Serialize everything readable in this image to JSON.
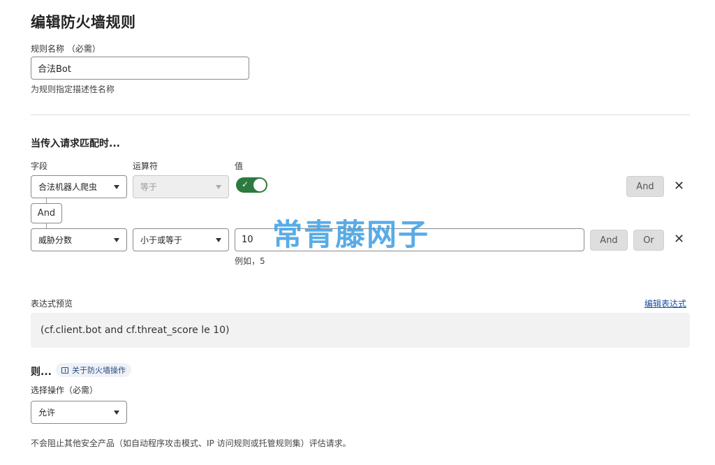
{
  "page": {
    "title": "编辑防火墙规则"
  },
  "rule_name": {
    "label": "规则名称 （必需）",
    "value": "合法Bot",
    "hint": "为规则指定描述性名称"
  },
  "match": {
    "heading": "当传入请求匹配时...",
    "col_field": "字段",
    "col_operator": "运算符",
    "col_value": "值",
    "row1": {
      "field": "合法机器人爬虫",
      "operator": "等于",
      "toggle_on": true,
      "and_label": "And"
    },
    "connector_label": "And",
    "row2": {
      "field": "威胁分数",
      "operator": "小于或等于",
      "value": "10",
      "value_hint": "例如，5",
      "and_label": "And",
      "or_label": "Or"
    }
  },
  "watermark": "常青藤网子",
  "expression": {
    "label": "表达式预览",
    "edit_link": "编辑表达式",
    "text": "(cf.client.bot and cf.threat_score le 10)"
  },
  "then": {
    "heading": "则...",
    "about_link": "关于防火墙操作",
    "action_label": "选择操作（必需）",
    "action_value": "允许",
    "note": "不会阻止其他安全产品（如自动程序攻击模式、IP 访问规则或托管规则集）评估请求。"
  },
  "colors": {
    "toggle": "#2c7a3f",
    "link": "#1a4f9c",
    "watermark": "#3b9ee3"
  }
}
